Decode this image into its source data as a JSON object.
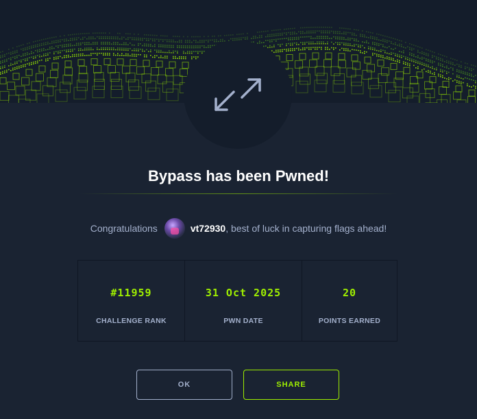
{
  "modal": {
    "title": "Bypass has been Pwned!",
    "congrats_prefix": "Congratulations",
    "username": "vt72930",
    "congrats_suffix": ", best of luck in capturing flags ahead!",
    "icon": "arrows-expand-icon"
  },
  "stats": [
    {
      "value": "#11959",
      "label": "CHALLENGE RANK"
    },
    {
      "value": "31 Oct 2025",
      "label": "PWN DATE"
    },
    {
      "value": "20",
      "label": "POINTS EARNED"
    }
  ],
  "buttons": {
    "ok_label": "OK",
    "share_label": "SHARE"
  },
  "colors": {
    "accent": "#9fef00",
    "background": "#1a2332",
    "panel": "#141d2b",
    "muted_text": "#a4b1cd"
  }
}
